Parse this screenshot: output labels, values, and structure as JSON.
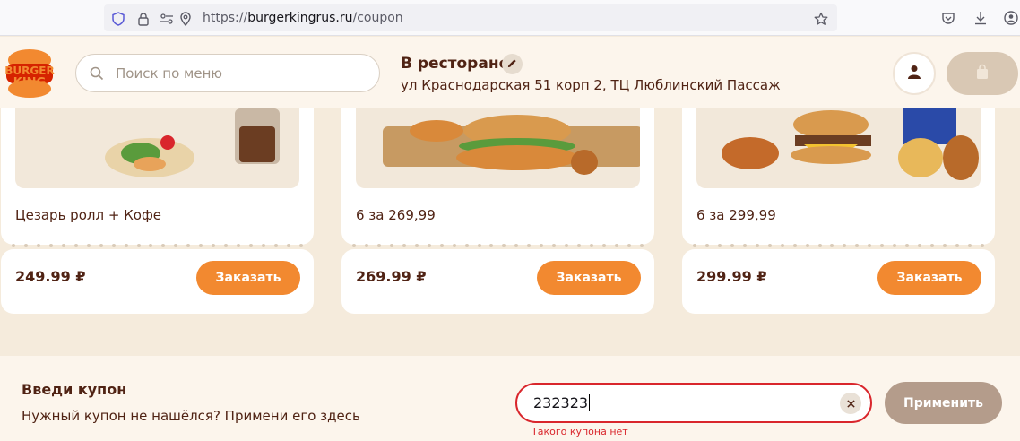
{
  "browser": {
    "url_scheme": "https://",
    "url_host": "burgerkingrus.ru",
    "url_path": "/coupon"
  },
  "header": {
    "logo_text_top": "BURGER",
    "logo_text_bottom": "KING",
    "search_placeholder": "Поиск по меню",
    "mode_title": "В ресторане",
    "address": "ул Краснодарская 51 корп 2, ТЦ Люблинский Пассаж"
  },
  "products": [
    {
      "name": "Цезарь ролл + Кофе",
      "price": "249.99 ₽",
      "order_label": "Заказать"
    },
    {
      "name": "6 за 269,99",
      "price": "269.99 ₽",
      "order_label": "Заказать"
    },
    {
      "name": "6 за 299,99",
      "price": "299.99 ₽",
      "order_label": "Заказать"
    }
  ],
  "coupon": {
    "title": "Введи купон",
    "subtitle": "Нужный купон не нашёлся? Примени его здесь",
    "value": "232323",
    "error": "Такого купона нет",
    "apply_label": "Применить"
  },
  "colors": {
    "brand_orange": "#f28930",
    "brand_brown": "#502314",
    "error_red": "#d9262c",
    "background": "#f5ebdc"
  }
}
